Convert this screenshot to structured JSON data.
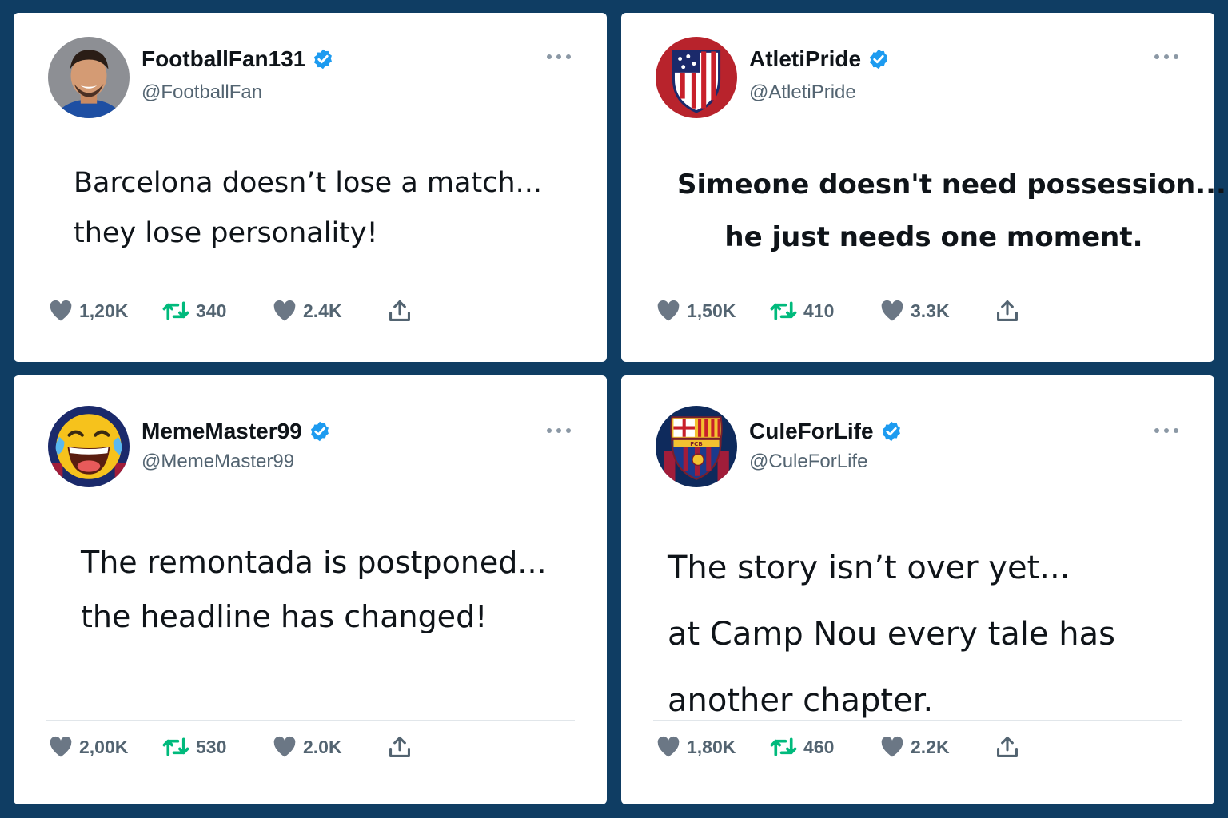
{
  "posts": [
    {
      "name": "FootballFan131",
      "handle": "@FootballFan",
      "lines": [
        "Barcelona doesn’t lose a match...",
        "they lose personality!"
      ],
      "likes": "1,20K",
      "retweets": "340",
      "likes2": "2.4K",
      "avatar": "player-photo"
    },
    {
      "name": "AtletiPride",
      "handle": "@AtletiPride",
      "lines": [
        "Simeone doesn't need possession...",
        "he just needs one moment."
      ],
      "likes": "1,50K",
      "retweets": "410",
      "likes2": "3.3K",
      "avatar": "atletico-crest"
    },
    {
      "name": "MemeMaster99",
      "handle": "@MemeMaster99",
      "lines": [
        "The remontada is postponed...",
        "the headline has changed!"
      ],
      "likes": "2,00K",
      "retweets": "530",
      "likes2": "2.0K",
      "avatar": "laughing-emoji"
    },
    {
      "name": "CuleForLife",
      "handle": "@CuleForLife",
      "lines": [
        "The story isn’t over yet...",
        "at Camp Nou every tale has",
        "another chapter."
      ],
      "likes": "1,80K",
      "retweets": "460",
      "likes2": "2.2K",
      "avatar": "barcelona-crest",
      "crest_text": "FCB"
    }
  ],
  "colors": {
    "background": "#0f3d63",
    "card": "#ffffff",
    "verified": "#1d9bf0",
    "retweet": "#00ba7c",
    "muted": "#536471",
    "heart": "#6b7785"
  }
}
